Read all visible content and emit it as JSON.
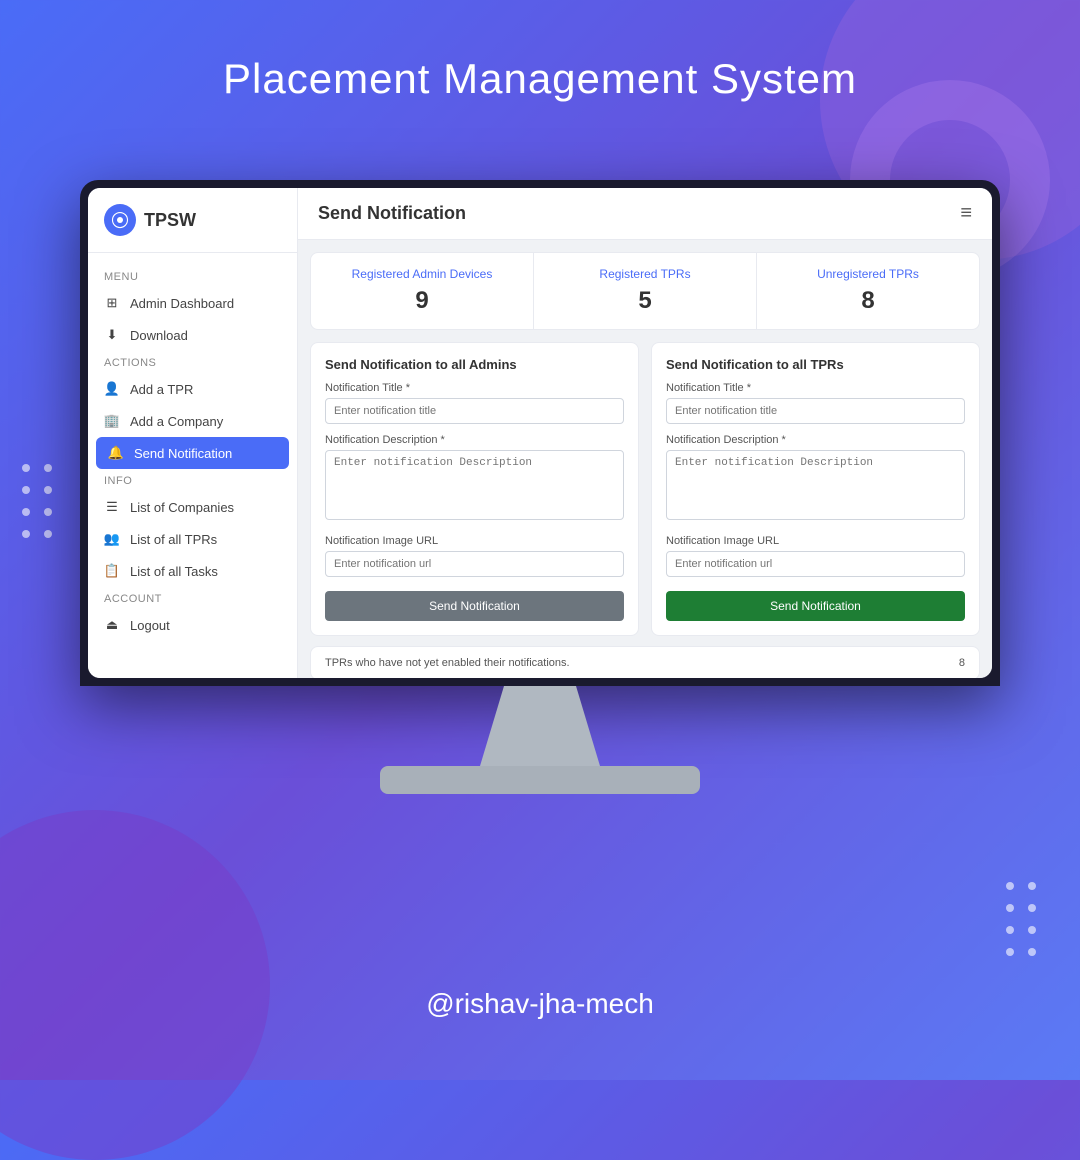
{
  "page": {
    "title": "Placement Management System",
    "footer_handle": "@rishav-jha-mech"
  },
  "sidebar": {
    "logo_text": "TPSW",
    "sections": [
      {
        "label": "Menu",
        "items": [
          {
            "id": "admin-dashboard",
            "label": "Admin Dashboard",
            "icon": "grid",
            "active": false
          },
          {
            "id": "download",
            "label": "Download",
            "icon": "download",
            "active": false
          }
        ]
      },
      {
        "label": "Actions",
        "items": [
          {
            "id": "add-tpr",
            "label": "Add a TPR",
            "icon": "user",
            "active": false
          },
          {
            "id": "add-company",
            "label": "Add a Company",
            "icon": "building",
            "active": false
          },
          {
            "id": "send-notification",
            "label": "Send Notification",
            "icon": "bell",
            "active": true
          }
        ]
      },
      {
        "label": "Info",
        "items": [
          {
            "id": "list-companies",
            "label": "List of Companies",
            "icon": "list",
            "active": false
          },
          {
            "id": "list-tprs",
            "label": "List of all TPRs",
            "icon": "users",
            "active": false
          },
          {
            "id": "list-tasks",
            "label": "List of all Tasks",
            "icon": "tasks",
            "active": false
          }
        ]
      },
      {
        "label": "Account",
        "items": [
          {
            "id": "logout",
            "label": "Logout",
            "icon": "logout",
            "active": false
          }
        ]
      }
    ]
  },
  "header": {
    "title": "Send Notification",
    "menu_icon": "hamburger"
  },
  "stats": [
    {
      "label": "Registered Admin Devices",
      "value": "9"
    },
    {
      "label": "Registered TPRs",
      "value": "5"
    },
    {
      "label": "Unregistered TPRs",
      "value": "8"
    }
  ],
  "panels": [
    {
      "id": "admins-panel",
      "title": "Send Notification to all Admins",
      "title_label_field": "Notification Title *",
      "title_placeholder": "Enter notification title",
      "desc_label": "Notification Description *",
      "desc_placeholder": "Enter notification Description",
      "url_label": "Notification Image URL",
      "url_placeholder": "Enter notification url",
      "button_label": "Send Notification",
      "button_style": "gray"
    },
    {
      "id": "tprs-panel",
      "title": "Send Notification to all TPRs",
      "title_label_field": "Notification Title *",
      "title_placeholder": "Enter notification title",
      "desc_label": "Notification Description *",
      "desc_placeholder": "Enter notification Description",
      "url_label": "Notification Image URL",
      "url_placeholder": "Enter notification url",
      "button_label": "Send Notification",
      "button_style": "green"
    }
  ],
  "bottom_bar": {
    "text": "TPRs who have not yet enabled their notifications.",
    "count": "8"
  }
}
